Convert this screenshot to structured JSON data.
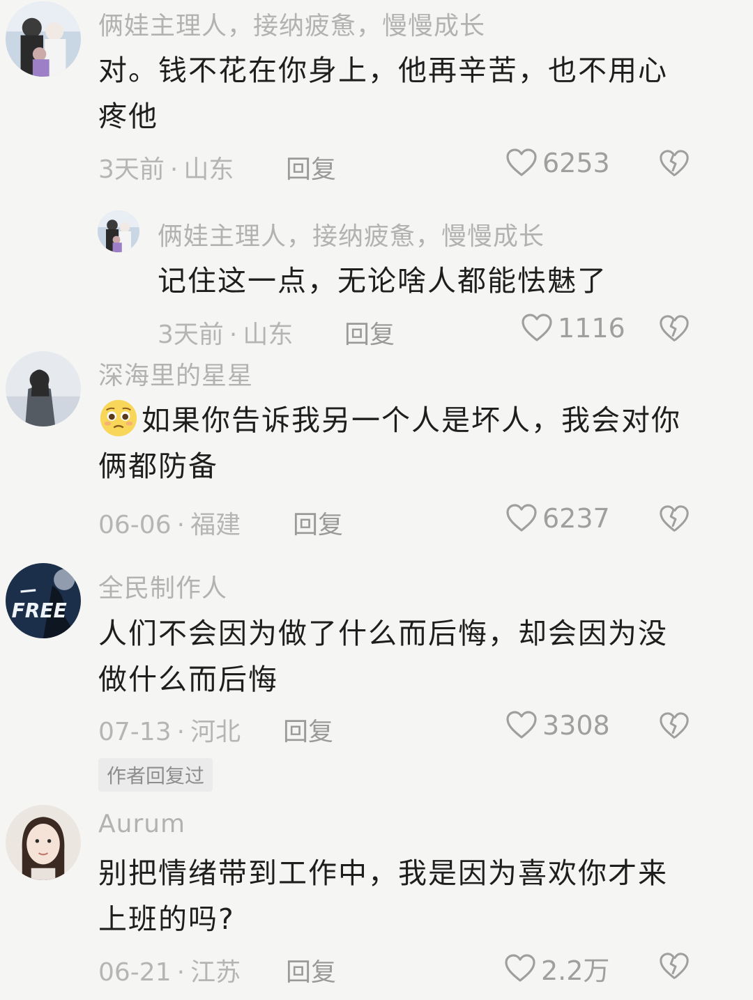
{
  "comments": [
    {
      "user": "俩娃主理人，接纳疲惫，慢慢成长",
      "text": "对。钱不花在你身上，他再辛苦，也不用心疼他",
      "time": "3天前",
      "location": "山东",
      "reply_label": "回复",
      "likes": "6253"
    },
    {
      "user": "俩娃主理人，接纳疲惫，慢慢成长",
      "text": "记住这一点，无论啥人都能怯魅了",
      "time": "3天前",
      "location": "山东",
      "reply_label": "回复",
      "likes": "1116"
    },
    {
      "user": "深海里的星星",
      "text": "如果你告诉我另一个人是坏人，我会对你俩都防备",
      "time": "06-06",
      "location": "福建",
      "reply_label": "回复",
      "likes": "6237"
    },
    {
      "user": "全民制作人",
      "text": "人们不会因为做了什么而后悔，却会因为没做什么而后悔",
      "time": "07-13",
      "location": "河北",
      "reply_label": "回复",
      "likes": "3308",
      "badge": "作者回复过"
    },
    {
      "user": "Aurum",
      "text": "别把情绪带到工作中，我是因为喜欢你才来上班的吗?",
      "time": "06-21",
      "location": "江苏",
      "reply_label": "回复",
      "likes": "2.2万"
    }
  ],
  "separator": "·",
  "icons": {
    "like": "heart-outline-icon",
    "dislike": "broken-heart-icon",
    "emoji": "pleading-face-emoji-icon"
  },
  "colors": {
    "background": "#f5f5f3",
    "username": "#b2b2b2",
    "text": "#1e1e1e",
    "meta": "#b5b5b5"
  }
}
